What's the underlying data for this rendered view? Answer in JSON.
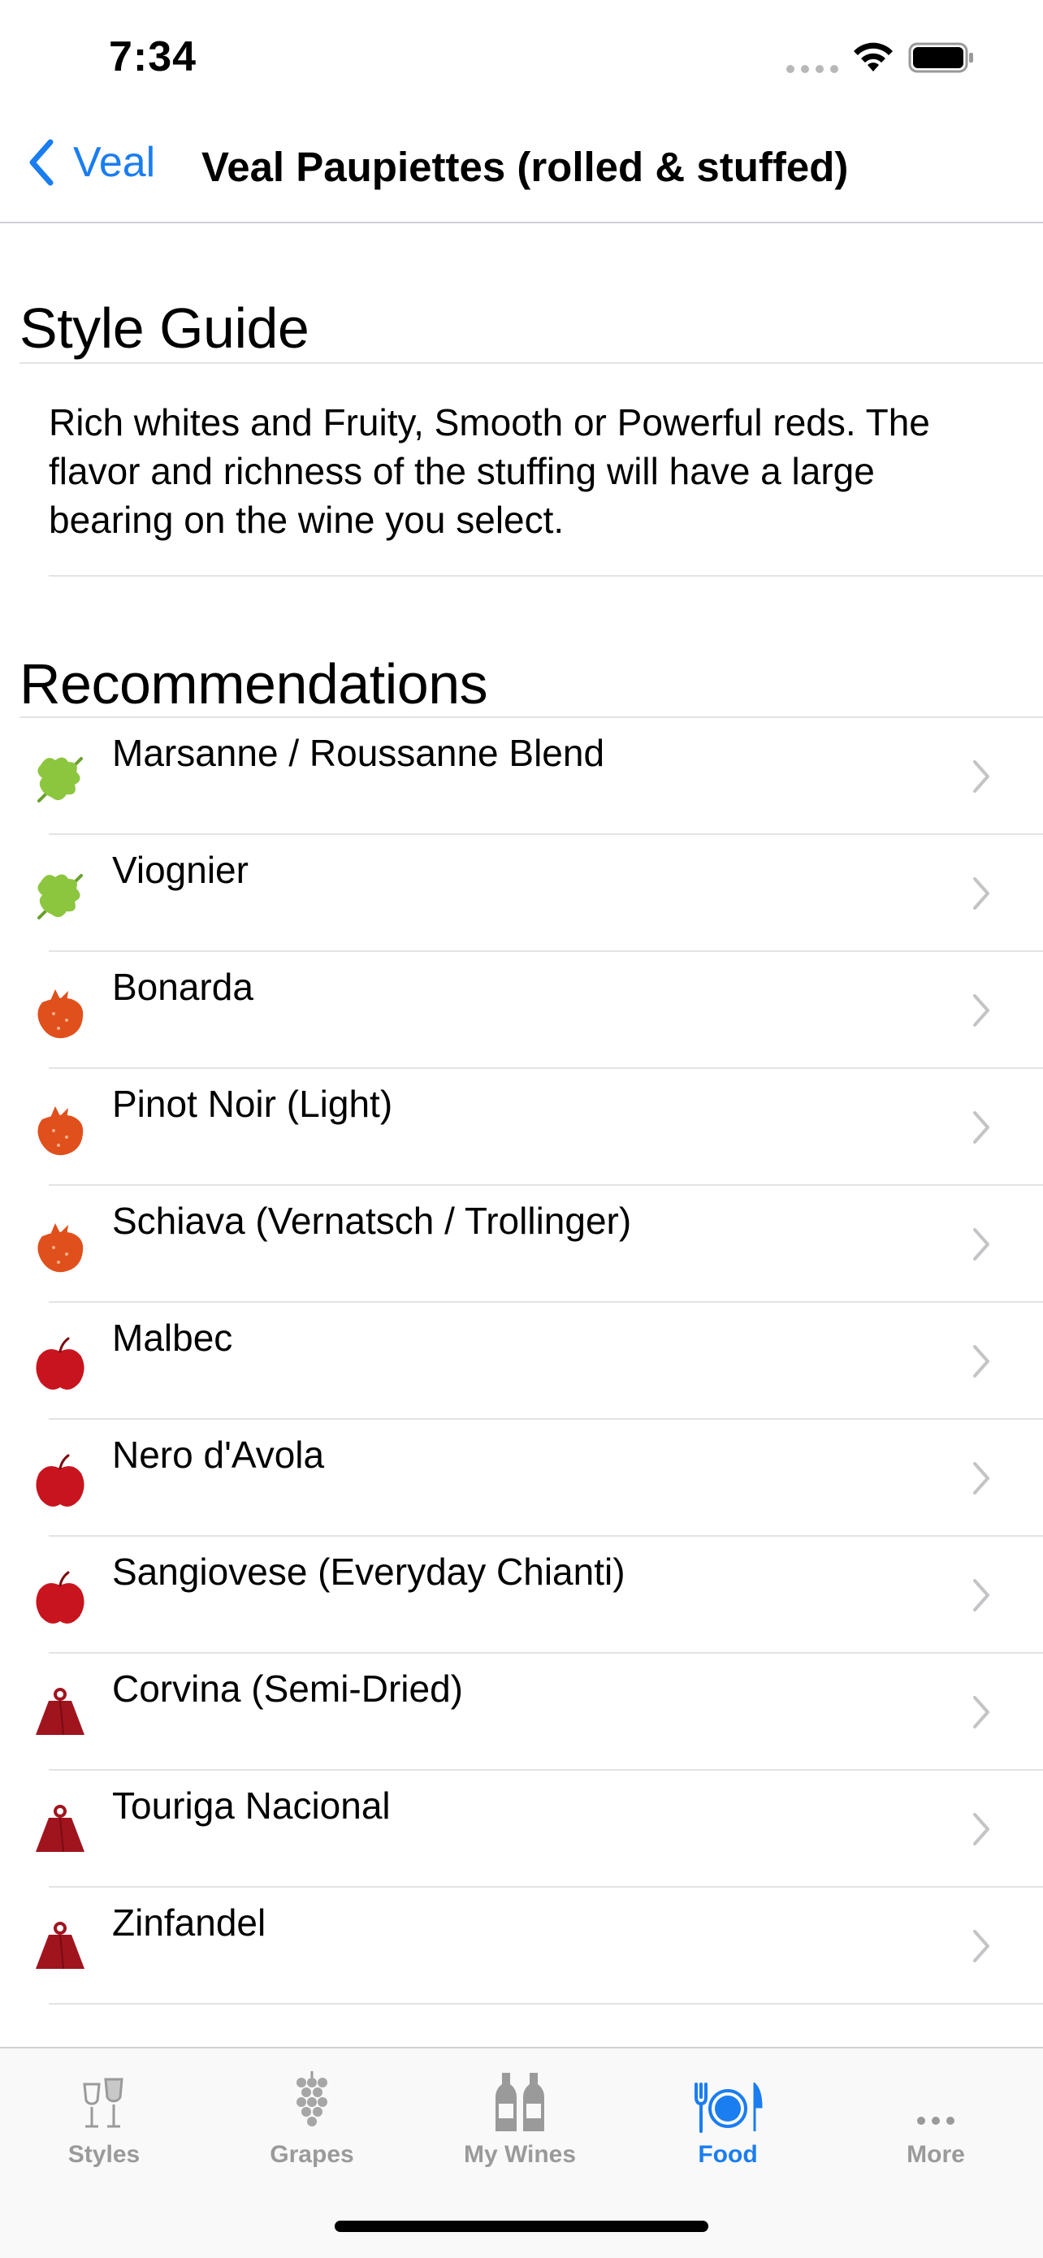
{
  "status_bar": {
    "time": "7:34"
  },
  "nav": {
    "back_label": "Veal",
    "title": "Veal Paupiettes (rolled & stuffed)"
  },
  "style_guide": {
    "heading": "Style Guide",
    "text": "Rich whites and Fruity, Smooth or Powerful reds. The flavor and richness of the stuffing will have a large bearing on the wine you select."
  },
  "recommendations": {
    "heading": "Recommendations",
    "items": [
      {
        "label": "Marsanne / Roussanne Blend",
        "icon": "leaf-icon"
      },
      {
        "label": "Viognier",
        "icon": "leaf-icon"
      },
      {
        "label": "Bonarda",
        "icon": "strawberry-icon"
      },
      {
        "label": "Pinot Noir (Light)",
        "icon": "strawberry-icon"
      },
      {
        "label": "Schiava (Vernatsch / Trollinger)",
        "icon": "strawberry-icon"
      },
      {
        "label": "Malbec",
        "icon": "apple-icon"
      },
      {
        "label": "Nero d'Avola",
        "icon": "apple-icon"
      },
      {
        "label": "Sangiovese (Everyday Chianti)",
        "icon": "apple-icon"
      },
      {
        "label": "Corvina (Semi-Dried)",
        "icon": "weight-icon"
      },
      {
        "label": "Touriga Nacional",
        "icon": "weight-icon"
      },
      {
        "label": "Zinfandel",
        "icon": "weight-icon"
      }
    ]
  },
  "tabs": [
    {
      "label": "Styles",
      "icon": "wine-glasses-icon",
      "active": false
    },
    {
      "label": "Grapes",
      "icon": "grapes-icon",
      "active": false
    },
    {
      "label": "My Wines",
      "icon": "bottles-icon",
      "active": false
    },
    {
      "label": "Food",
      "icon": "plate-cutlery-icon",
      "active": true
    },
    {
      "label": "More",
      "icon": "more-dots-icon",
      "active": false
    }
  ],
  "colors": {
    "accent": "#1a7df0",
    "leaf": "#8cc63f",
    "strawberry": "#e0501c",
    "apple": "#c8141e",
    "weight": "#a0141e",
    "inactive_tab": "#9a9a9a"
  }
}
